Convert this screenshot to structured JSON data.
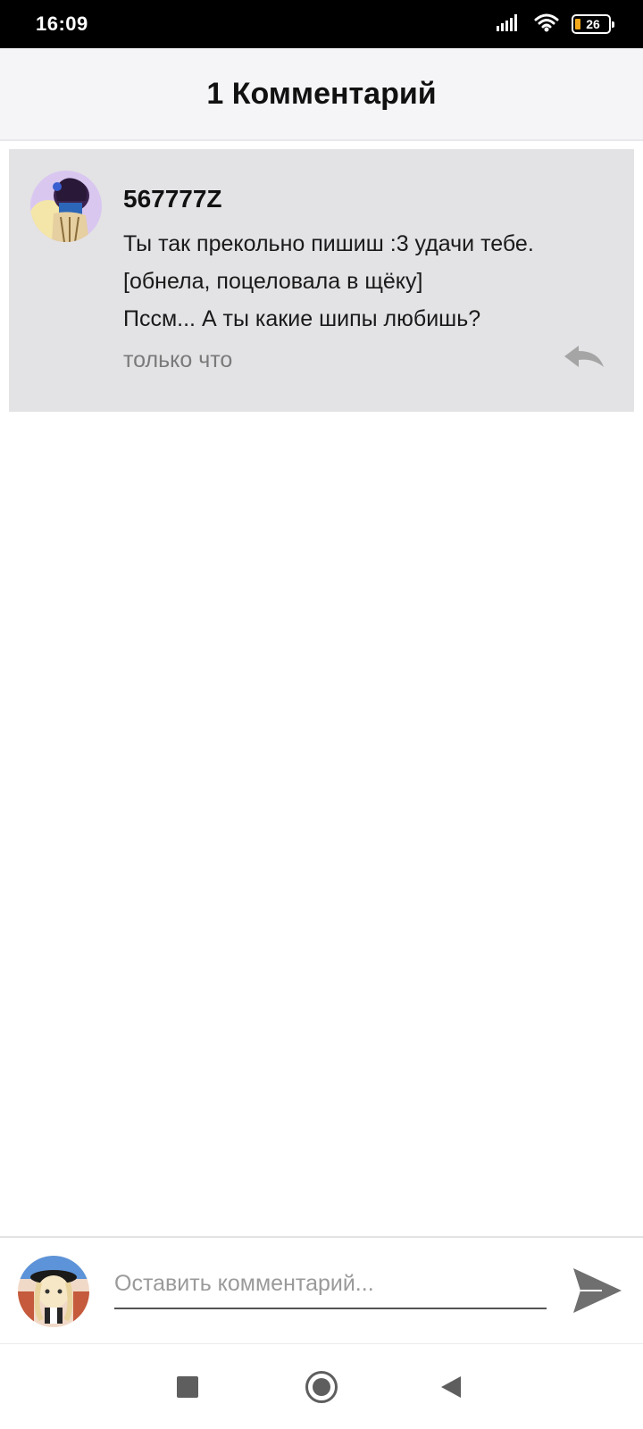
{
  "status_bar": {
    "time": "16:09",
    "battery": "26",
    "icons": [
      "signal-icon",
      "wifi-icon",
      "battery-icon"
    ],
    "battery_accent": "#f3a91b"
  },
  "header": {
    "title": "1 Комментарий"
  },
  "comments": [
    {
      "author": "567777Z",
      "lines": [
        "Ты так прекольно пишиш :3 удачи тебе.",
        "[обнела, поцеловала в щёку]",
        "Пссм... А ты какие шипы любишь?"
      ],
      "time": "только что",
      "reply_icon": "reply-icon"
    }
  ],
  "composer": {
    "placeholder": "Оставить комментарий...",
    "send_icon": "send-icon"
  },
  "nav": {
    "icons": [
      "recents-icon",
      "home-icon",
      "back-icon"
    ]
  },
  "colors": {
    "header_bg": "#f5f4f7",
    "comment_bg": "#e3e2e5",
    "muted_text": "#7a7a7a",
    "icon_gray": "#a5a5a5"
  }
}
